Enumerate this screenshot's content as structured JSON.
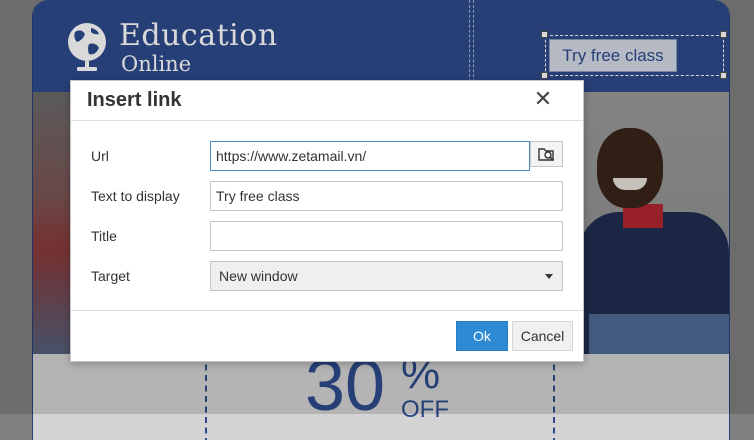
{
  "background": {
    "brand_line1": "Education",
    "brand_line2": "Online",
    "header_button": "Try free class",
    "promo_number": "30",
    "promo_percent": "%",
    "promo_off": "OFF",
    "logo_icon": "globe-logo-icon"
  },
  "dialog": {
    "title": "Insert link",
    "close_icon": "close-icon",
    "fields": {
      "url": {
        "label": "Url",
        "value": "https://www.zetamail.vn/"
      },
      "text_to_display": {
        "label": "Text to display",
        "value": "Try free class"
      },
      "title": {
        "label": "Title",
        "value": ""
      },
      "target": {
        "label": "Target",
        "value": "New window"
      }
    },
    "browse_icon": "browse-files-icon",
    "ok_label": "Ok",
    "cancel_label": "Cancel"
  },
  "colors": {
    "header_blue": "#2e4a8c",
    "ok_blue": "#2e8ad3",
    "focus_border": "#4e90c5"
  }
}
